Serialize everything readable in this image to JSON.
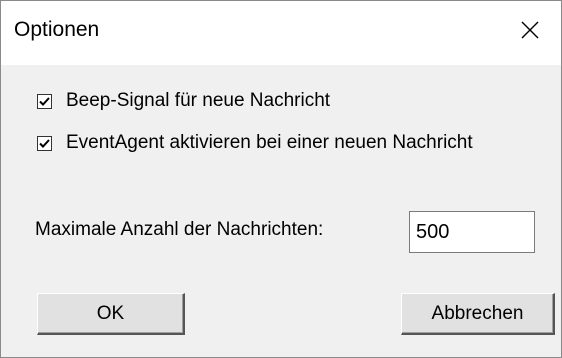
{
  "dialog": {
    "title": "Optionen",
    "close_icon": "close-icon"
  },
  "options": {
    "beep": {
      "label": "Beep-Signal für neue Nachricht",
      "checked": true
    },
    "event_agent": {
      "label": "EventAgent aktivieren bei einer neuen Nachricht",
      "checked": true
    }
  },
  "max_messages": {
    "label": "Maximale Anzahl der Nachrichten:",
    "value": "500"
  },
  "buttons": {
    "ok_label": "OK",
    "cancel_label": "Abbrechen"
  }
}
